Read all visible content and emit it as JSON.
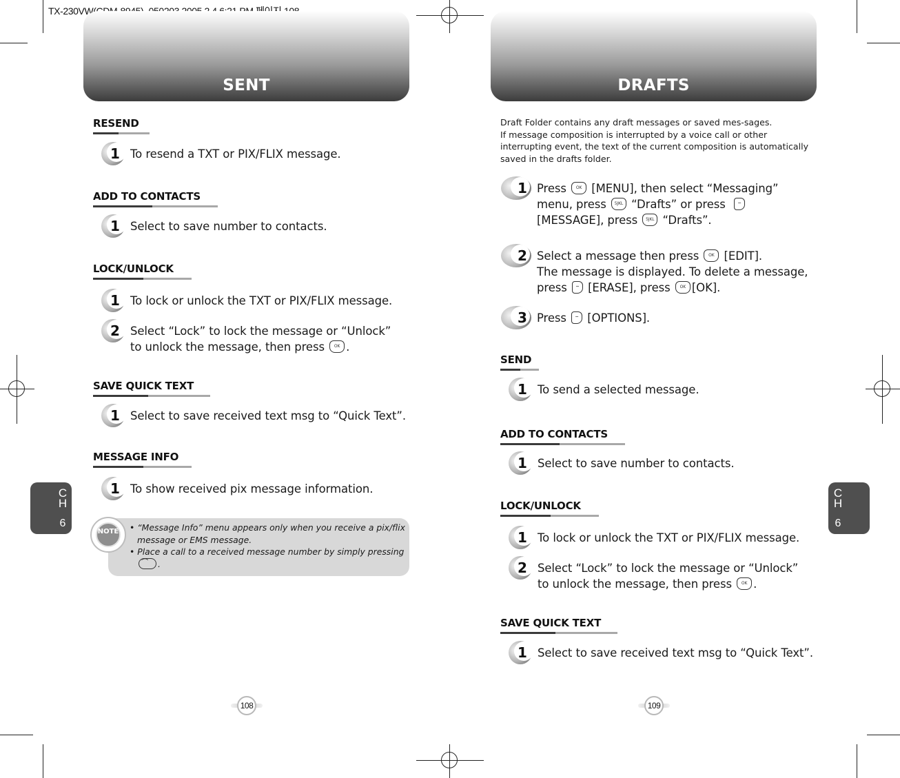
{
  "print_header": "TX-230VW(CDM-8945)_050203  2005.2.4 6:21 PM 페이지 108",
  "left_page": {
    "title": "SENT",
    "page_number": "108",
    "chapter_tab": {
      "label": "CH",
      "number": "6"
    },
    "sections": [
      {
        "heading": "RESEND",
        "steps": [
          {
            "num": "1",
            "lines": [
              "To resend a TXT or PIX/FLIX message."
            ]
          }
        ]
      },
      {
        "heading": "ADD TO CONTACTS",
        "steps": [
          {
            "num": "1",
            "lines": [
              "Select to save number to contacts."
            ]
          }
        ]
      },
      {
        "heading": "LOCK/UNLOCK",
        "steps": [
          {
            "num": "1",
            "lines": [
              "To lock or unlock the TXT or PIX/FLIX message."
            ]
          },
          {
            "num": "2",
            "lines": [
              "Select “Lock” to lock the message or “Unlock”",
              "to unlock the message, then press",
              "."
            ]
          }
        ]
      },
      {
        "heading": "SAVE QUICK TEXT",
        "steps": [
          {
            "num": "1",
            "lines": [
              "Select to save received text msg to “Quick Text”."
            ]
          }
        ]
      },
      {
        "heading": "MESSAGE INFO",
        "steps": [
          {
            "num": "1",
            "lines": [
              "To show received pix message information."
            ]
          }
        ]
      }
    ],
    "note": {
      "icon_label": "NOTE",
      "items": [
        "“Message Info” menu appears only when you receive a pix/flix message or EMS message.",
        "Place a call to a received message number by simply pressing"
      ],
      "item2_suffix": "."
    }
  },
  "right_page": {
    "title": "DRAFTS",
    "page_number": "109",
    "chapter_tab": {
      "label": "CH",
      "number": "6"
    },
    "intro": [
      "Draft Folder contains any draft messages or saved mes-sages.",
      "If message composition is interrupted by a voice call or other",
      "interrupting event, the text of the current composition is automatically",
      "saved in the drafts folder."
    ],
    "main_steps": [
      {
        "num": "1",
        "parts": {
          "a": "Press",
          "b": "[MENU], then select “Messaging”",
          "c": "menu, press",
          "d": "“Drafts” or press",
          "e": "[MESSAGE], press",
          "f": "“Drafts”."
        }
      },
      {
        "num": "2",
        "parts": {
          "a": "Select a message then press",
          "b": "[EDIT].",
          "c": "The message is displayed. To delete a message,",
          "d": "press",
          "e": "[ERASE], press",
          "f": "[OK]."
        }
      },
      {
        "num": "3",
        "parts": {
          "a": "Press",
          "b": "[OPTIONS]."
        }
      }
    ],
    "sections": [
      {
        "heading": "SEND",
        "steps": [
          {
            "num": "1",
            "lines": [
              "To send a selected message."
            ]
          }
        ]
      },
      {
        "heading": "ADD TO CONTACTS",
        "steps": [
          {
            "num": "1",
            "lines": [
              "Select to save number to contacts."
            ]
          }
        ]
      },
      {
        "heading": "LOCK/UNLOCK",
        "steps": [
          {
            "num": "1",
            "lines": [
              "To lock or unlock the TXT or PIX/FLIX message."
            ]
          },
          {
            "num": "2",
            "lines": [
              "Select “Lock” to lock the message or “Unlock”",
              "to unlock the message, then press",
              "."
            ]
          }
        ]
      },
      {
        "heading": "SAVE QUICK TEXT",
        "steps": [
          {
            "num": "1",
            "lines": [
              "Select to save received text msg to “Quick Text”."
            ]
          }
        ]
      }
    ]
  },
  "keys": {
    "ok": "OK",
    "five": "5JKL",
    "soft_left": "–",
    "soft_right": "–",
    "send": "⌒"
  }
}
